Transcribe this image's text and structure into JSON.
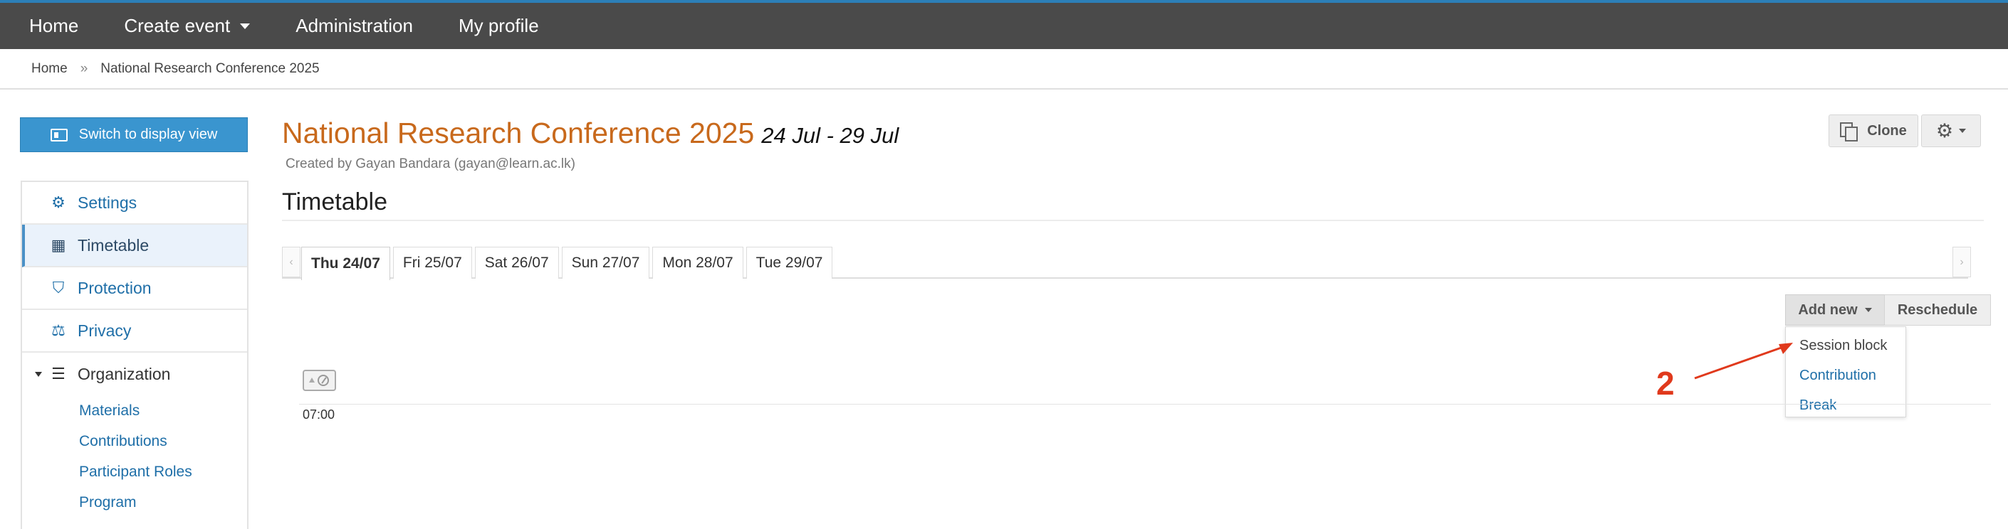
{
  "nav": {
    "home": "Home",
    "create_event": "Create event",
    "administration": "Administration",
    "my_profile": "My profile"
  },
  "breadcrumb": {
    "home": "Home",
    "separator": "»",
    "current": "National Research Conference 2025"
  },
  "sidebar": {
    "switch_button": "Switch to display view",
    "items": [
      {
        "label": "Settings",
        "icon": "gear-icon"
      },
      {
        "label": "Timetable",
        "icon": "calendar-icon",
        "active": true
      },
      {
        "label": "Protection",
        "icon": "shield-icon"
      },
      {
        "label": "Privacy",
        "icon": "scale-icon"
      },
      {
        "label": "Organization",
        "icon": "list-icon",
        "expanded": true
      }
    ],
    "sub_items": [
      "Materials",
      "Contributions",
      "Participant Roles",
      "Program"
    ]
  },
  "event": {
    "title": "National Research Conference 2025",
    "dates": "24 Jul - 29 Jul",
    "created_by": "Created by Gayan Bandara (gayan@learn.ac.lk)"
  },
  "toolbar": {
    "clone": "Clone"
  },
  "section": {
    "title": "Timetable"
  },
  "day_tabs": [
    {
      "label": "Thu 24/07",
      "active": true
    },
    {
      "label": "Fri 25/07"
    },
    {
      "label": "Sat 26/07"
    },
    {
      "label": "Sun 27/07"
    },
    {
      "label": "Mon 28/07"
    },
    {
      "label": "Tue 29/07"
    }
  ],
  "actions": {
    "add_new": "Add new",
    "reschedule": "Reschedule",
    "dropdown": [
      "Session block",
      "Contribution",
      "Break"
    ]
  },
  "timeline": {
    "first_time": "07:00"
  },
  "annotation": {
    "step": "2",
    "color": "#e0391c"
  },
  "colors": {
    "nav_bg": "#4a4a4a",
    "accent_blue": "#3a95cf",
    "title_orange": "#c8691c",
    "link_blue": "#1f6fa8"
  }
}
